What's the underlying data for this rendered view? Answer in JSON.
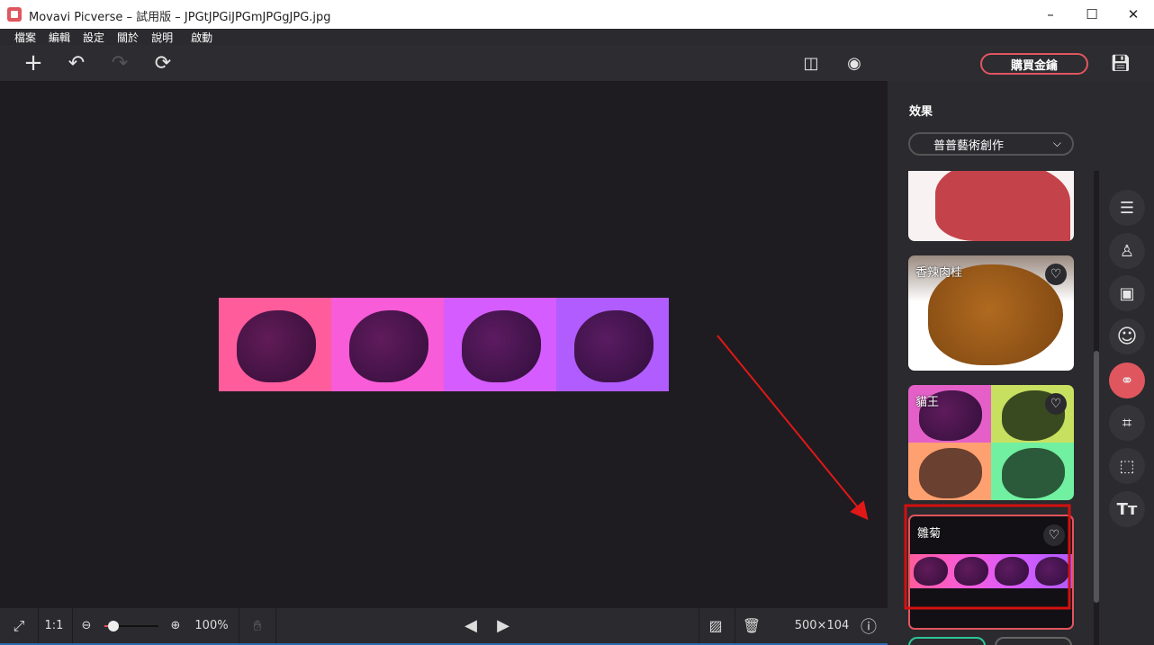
{
  "window": {
    "title": "Movavi Picverse – 試用版 – JPGtJPGiJPGmJPGgJPG.jpg",
    "minimize": "–",
    "maximize": "☐",
    "close": "✕"
  },
  "menu": [
    "檔案",
    "編輯",
    "設定",
    "關於",
    "說明",
    "啟動"
  ],
  "toolbar": {
    "buy_label": "購買金鑰"
  },
  "canvas": {
    "tile_colors": [
      "#ff5c9c",
      "#f85cd8",
      "#d55cff",
      "#b05cff"
    ]
  },
  "panel": {
    "heading": "效果",
    "category": "普普藝術創作",
    "cards": [
      {
        "label": ""
      },
      {
        "label": "香辣肉桂"
      },
      {
        "label": "貓王"
      },
      {
        "label": "雛菊",
        "selected": true
      }
    ]
  },
  "bottom": {
    "ratio": "1:1",
    "zoom": "100%",
    "dimensions": "500×104",
    "zoom_level": 1.0
  },
  "accent": "#e0565f"
}
